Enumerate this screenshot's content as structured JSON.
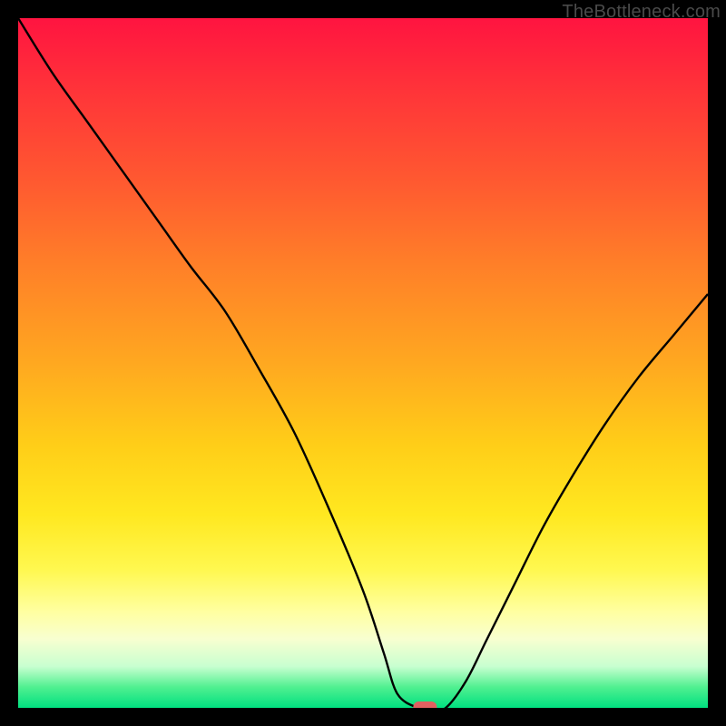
{
  "watermark": "TheBottleneck.com",
  "colors": {
    "frame": "#000000",
    "curve": "#000000",
    "marker": "#e06060"
  },
  "chart_data": {
    "type": "line",
    "title": "",
    "xlabel": "",
    "ylabel": "",
    "xlim": [
      0,
      100
    ],
    "ylim": [
      0,
      100
    ],
    "grid": false,
    "series": [
      {
        "name": "bottleneck-curve",
        "x": [
          0,
          5,
          10,
          15,
          20,
          25,
          30,
          35,
          40,
          45,
          50,
          53,
          55,
          58,
          60,
          62,
          65,
          68,
          72,
          76,
          80,
          85,
          90,
          95,
          100
        ],
        "values": [
          100,
          92,
          85,
          78,
          71,
          64,
          57.5,
          49,
          40,
          29,
          17,
          8,
          2,
          0,
          0,
          0,
          4,
          10,
          18,
          26,
          33,
          41,
          48,
          54,
          60
        ]
      }
    ],
    "marker": {
      "x": 59,
      "y": 0,
      "shape": "pill"
    },
    "background": {
      "type": "vertical-gradient",
      "stops": [
        {
          "pos": 0.0,
          "color": "#ff1440"
        },
        {
          "pos": 0.12,
          "color": "#ff3838"
        },
        {
          "pos": 0.24,
          "color": "#ff5a30"
        },
        {
          "pos": 0.36,
          "color": "#ff8028"
        },
        {
          "pos": 0.5,
          "color": "#ffa820"
        },
        {
          "pos": 0.62,
          "color": "#ffce18"
        },
        {
          "pos": 0.72,
          "color": "#ffe820"
        },
        {
          "pos": 0.8,
          "color": "#fff850"
        },
        {
          "pos": 0.86,
          "color": "#ffffa0"
        },
        {
          "pos": 0.9,
          "color": "#f8ffd0"
        },
        {
          "pos": 0.94,
          "color": "#c8ffd0"
        },
        {
          "pos": 0.97,
          "color": "#50f090"
        },
        {
          "pos": 1.0,
          "color": "#00e080"
        }
      ]
    }
  }
}
